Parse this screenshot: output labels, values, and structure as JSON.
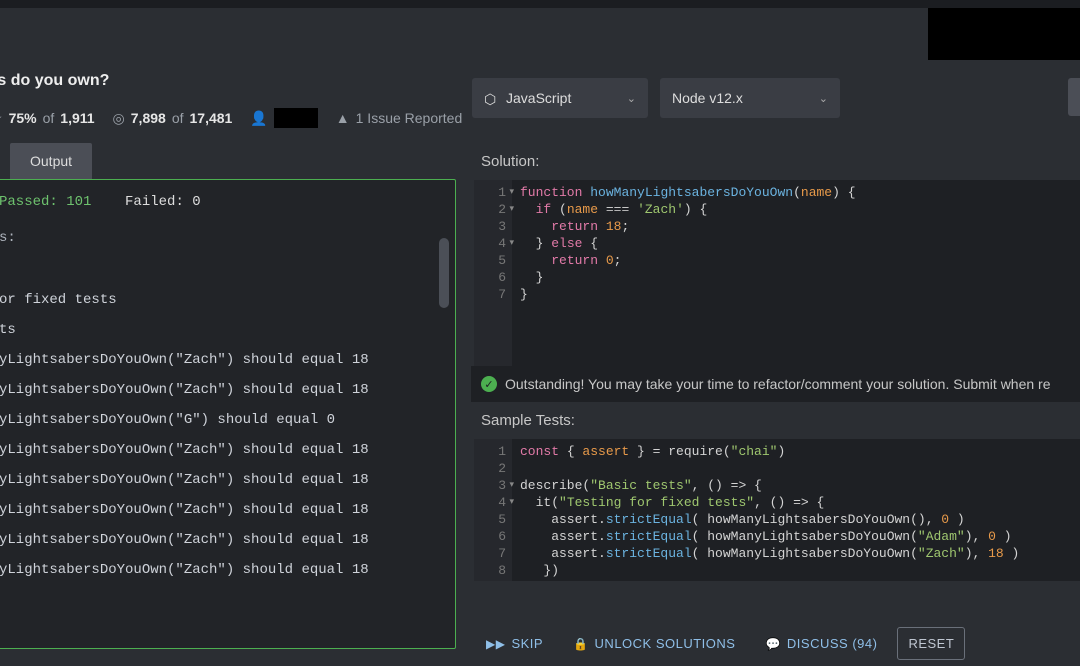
{
  "title": "_any lightsabers do you own?",
  "stats": {
    "star_pct": "75%",
    "star_of_label": "of",
    "star_total": "1,911",
    "completed": "7,898",
    "completed_of_label": "of",
    "completed_total": "17,481",
    "issues_label": "1 Issue Reported"
  },
  "dropdowns": {
    "language": "JavaScript",
    "runtime": "Node v12.x"
  },
  "left": {
    "tab_label": "Output",
    "passed_label": "Passed: 101",
    "failed_label": "Failed: 0",
    "heading1": "s:",
    "heading2": "or fixed tests",
    "heading3": "ts",
    "lines": [
      "yLightsabersDoYouOwn(\"Zach\") should equal 18",
      "yLightsabersDoYouOwn(\"Zach\") should equal 18",
      "yLightsabersDoYouOwn(\"G\") should equal 0",
      "yLightsabersDoYouOwn(\"Zach\") should equal 18",
      "yLightsabersDoYouOwn(\"Zach\") should equal 18",
      "yLightsabersDoYouOwn(\"Zach\") should equal 18",
      "yLightsabersDoYouOwn(\"Zach\") should equal 18",
      "yLightsabersDoYouOwn(\"Zach\") should equal 18"
    ]
  },
  "right": {
    "solution_label": "Solution:",
    "success_msg": "Outstanding! You may take your time to refactor/comment your solution. Submit when re",
    "sample_label": "Sample Tests:"
  },
  "buttons": {
    "skip": "SKIP",
    "unlock": "UNLOCK SOLUTIONS",
    "discuss": "DISCUSS (94)",
    "reset": "RESET"
  },
  "icons": {
    "star": "★",
    "target": "◎",
    "user": "👤",
    "warn": "▲",
    "js": "⬡",
    "chev": "⌄",
    "check": "✓",
    "skip": "▶▶",
    "lock": "🔒",
    "chat": "💬"
  }
}
